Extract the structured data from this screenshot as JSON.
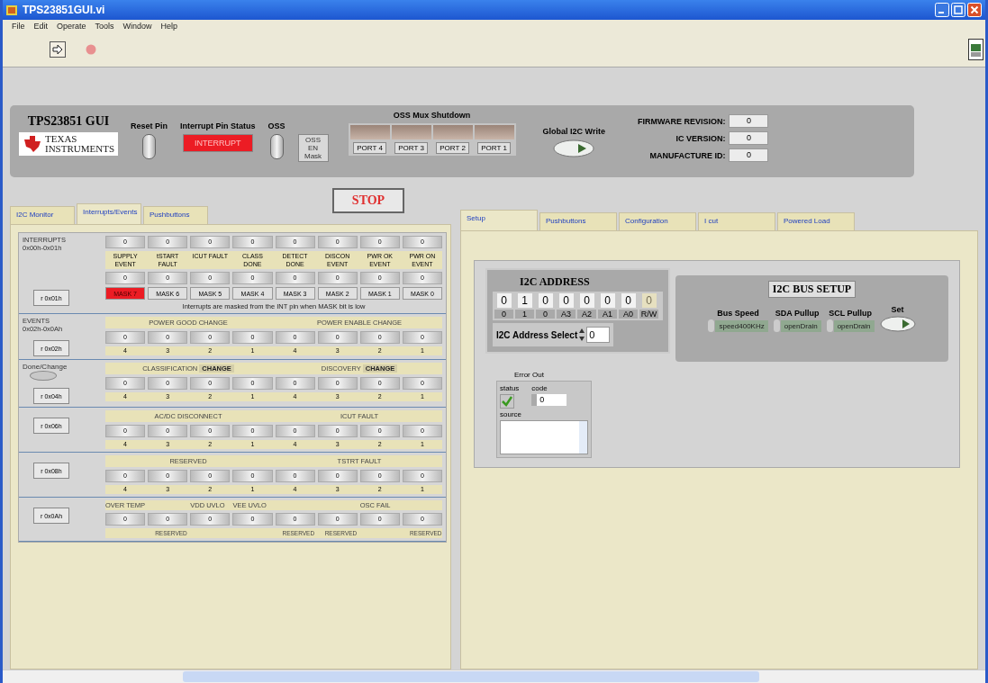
{
  "window": {
    "title": "TPS23851GUI.vi"
  },
  "menu": [
    "File",
    "Edit",
    "Operate",
    "Tools",
    "Window",
    "Help"
  ],
  "header": {
    "title": "TPS23851 GUI",
    "logo_text": [
      "TEXAS",
      "INSTRUMENTS"
    ],
    "reset_pin": {
      "label": "Reset Pin",
      "on": false
    },
    "interrupt": {
      "label": "Interrupt Pin Status",
      "text": "INTERRUPT",
      "on": true
    },
    "oss": {
      "label": "OSS",
      "on": false
    },
    "oss_mask_button": "OSS EN Mask",
    "oss_mux": {
      "label": "OSS Mux Shutdown",
      "ports": [
        {
          "label": "PORT 4",
          "on": false
        },
        {
          "label": "PORT 3",
          "on": false
        },
        {
          "label": "PORT 2",
          "on": false
        },
        {
          "label": "PORT 1",
          "on": false
        }
      ]
    },
    "global_write": {
      "label": "Global I2C Write"
    },
    "info": [
      {
        "label": "FIRMWARE REVISION:",
        "value": "0"
      },
      {
        "label": "IC VERSION:",
        "value": "0"
      },
      {
        "label": "MANUFACTURE ID:",
        "value": "0"
      }
    ]
  },
  "stop_button": "STOP",
  "left_tabs": [
    {
      "label": "I2C Monitor",
      "selected": false
    },
    {
      "label": "Interrupts/Events",
      "selected": true
    },
    {
      "label": "Pushbuttons",
      "selected": false
    }
  ],
  "right_tabs": [
    {
      "label": "Setup",
      "selected": true
    },
    {
      "label": "Pushbuttons",
      "selected": false
    },
    {
      "label": "Configuration",
      "selected": false
    },
    {
      "label": "I cut",
      "selected": false
    },
    {
      "label": "Powered Load",
      "selected": false
    }
  ],
  "interrupts": {
    "label": "INTERRUPTS",
    "range": "0x00h-0x01h",
    "values": [
      "0",
      "0",
      "0",
      "0",
      "0",
      "0",
      "0",
      "0"
    ],
    "labels": [
      "SUPPLY EVENT",
      "tSTART FAULT",
      "ICUT FAULT",
      "CLASS DONE",
      "DETECT DONE",
      "DISCON EVENT",
      "PWR OK EVENT",
      "PWR ON EVENT"
    ],
    "values2": [
      "0",
      "0",
      "0",
      "0",
      "0",
      "0",
      "0",
      "0"
    ],
    "button": "r 0x01h",
    "masks": [
      {
        "label": "MASK 7",
        "on": true
      },
      {
        "label": "MASK 6",
        "on": false
      },
      {
        "label": "MASK 5",
        "on": false
      },
      {
        "label": "MASK 4",
        "on": false
      },
      {
        "label": "MASK 3",
        "on": false
      },
      {
        "label": "MASK 2",
        "on": false
      },
      {
        "label": "MASK 1",
        "on": false
      },
      {
        "label": "MASK 0",
        "on": false
      }
    ],
    "note": "Interrupts are masked from the INT pin when MASK bit is low"
  },
  "event_groups": [
    {
      "kind": "halves",
      "label": "EVENTS",
      "range": "0x02h-0x0Ah",
      "button": "r 0x02h",
      "headers": [
        "POWER GOOD CHANGE",
        "POWER ENABLE CHANGE"
      ],
      "values": [
        "0",
        "0",
        "0",
        "0",
        "0",
        "0",
        "0",
        "0"
      ],
      "bits": [
        "4",
        "3",
        "2",
        "1",
        "4",
        "3",
        "2",
        "1"
      ]
    },
    {
      "kind": "halves",
      "led": {
        "label": "Done/Change",
        "on": false
      },
      "button": "r 0x04h",
      "headers": [
        "CLASSIFICATION **CHANGE**",
        "DISCOVERY **CHANGE**"
      ],
      "values": [
        "0",
        "0",
        "0",
        "0",
        "0",
        "0",
        "0",
        "0"
      ],
      "bits": [
        "4",
        "3",
        "2",
        "1",
        "4",
        "3",
        "2",
        "1"
      ]
    },
    {
      "kind": "halves",
      "button": "r 0x06h",
      "headers": [
        "AC/DC DISCONNECT",
        "ICUT FAULT"
      ],
      "values": [
        "0",
        "0",
        "0",
        "0",
        "0",
        "0",
        "0",
        "0"
      ],
      "bits": [
        "4",
        "3",
        "2",
        "1",
        "4",
        "3",
        "2",
        "1"
      ]
    },
    {
      "kind": "halves",
      "button": "r 0x08h",
      "headers": [
        "RESERVED",
        "TSTRT FAULT"
      ],
      "values": [
        "0",
        "0",
        "0",
        "0",
        "0",
        "0",
        "0",
        "0"
      ],
      "bits": [
        "4",
        "3",
        "2",
        "1",
        "4",
        "3",
        "2",
        "1"
      ]
    },
    {
      "kind": "labeled",
      "button": "r 0x0Ah",
      "cells": [
        {
          "value": "0",
          "top": "OVER TEMP"
        },
        {
          "value": "0",
          "bottom": "RESERVED"
        },
        {
          "value": "0",
          "top": "VDD UVLO"
        },
        {
          "value": "0",
          "top": "VEE UVLO"
        },
        {
          "value": "0",
          "bottom": "RESERVED"
        },
        {
          "value": "0",
          "bottom": "RESERVED"
        },
        {
          "value": "0",
          "top": "OSC FAIL"
        },
        {
          "value": "0",
          "bottom": "RESERVED"
        }
      ]
    }
  ],
  "i2c_address": {
    "title": "I2C ADDRESS",
    "bits": [
      {
        "value": "0",
        "label": "0",
        "disabled": false
      },
      {
        "value": "1",
        "label": "1",
        "disabled": false
      },
      {
        "value": "0",
        "label": "0",
        "disabled": false
      },
      {
        "value": "0",
        "label": "A3",
        "disabled": false
      },
      {
        "value": "0",
        "label": "A2",
        "disabled": false
      },
      {
        "value": "0",
        "label": "A1",
        "disabled": false
      },
      {
        "value": "0",
        "label": "A0",
        "disabled": false
      },
      {
        "value": "0",
        "label": "R/W",
        "disabled": true
      }
    ],
    "select_label": "I2C Address Select",
    "select_value": "0"
  },
  "bus_setup": {
    "title": "I2C BUS SETUP",
    "controls": [
      {
        "label": "Bus Speed",
        "value": "speed400KHz"
      },
      {
        "label": "SDA Pullup",
        "value": "openDrain"
      },
      {
        "label": "SCL Pullup",
        "value": "openDrain"
      }
    ],
    "set_label": "Set"
  },
  "error_out": {
    "title": "Error Out",
    "status_label": "status",
    "error": false,
    "code_label": "code",
    "code": "0",
    "source_label": "source"
  }
}
